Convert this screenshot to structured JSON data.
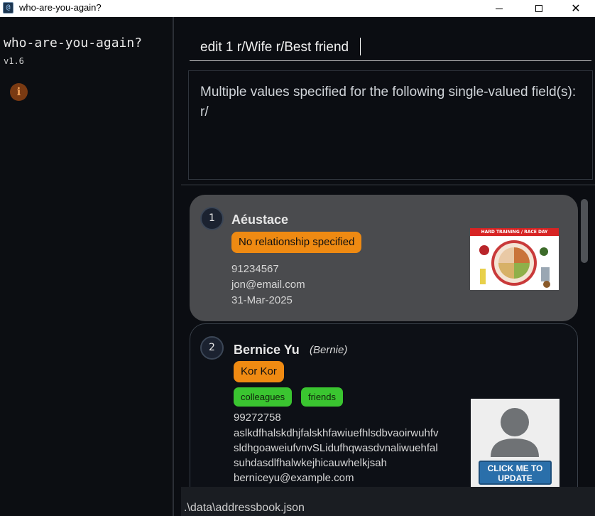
{
  "window": {
    "title": "who-are-you-again?",
    "icon": "app-icon",
    "minimize_glyph": "",
    "close_glyph": "✕"
  },
  "sidebar": {
    "app_name": "who-are-you-again?",
    "version": "v1.6",
    "info_icon": "i"
  },
  "command": {
    "value": "edit 1 r/Wife r/Best friend"
  },
  "result": {
    "message": "Multiple values specified for the following single-valued field(s): r/"
  },
  "persons": [
    {
      "index": "1",
      "name": "Aéustace",
      "relationship": "No relationship specified",
      "phone": "91234567",
      "email": "jon@email.com",
      "date": "31-Mar-2025",
      "photo_caption": "HARD TRAINING / RACE DAY"
    },
    {
      "index": "2",
      "name": "Bernice Yu",
      "nickname": "(Bernie)",
      "relationship": "Kor Kor",
      "tags": [
        "colleagues",
        "friends"
      ],
      "phone": "99272758",
      "address_lines": [
        "aslkdfhalskdhjfalskhfawiuefhlsdbvaoirwuhfv",
        "sldhgoaweiufvnvSLidufhqwasdvnaliwuehfal",
        "suhdasdlfhalwkejhicauwhelkjsah"
      ],
      "email": "berniceyu@example.com",
      "photo_button": "CLICK ME TO UPDATE"
    }
  ],
  "status": {
    "path": ".\\data\\addressbook.json"
  },
  "colors": {
    "relationship_badge": "#ef8a12",
    "tag": "#3ac530",
    "selected_card": "#4a4b4e",
    "info_icon": "#7a3a12"
  }
}
